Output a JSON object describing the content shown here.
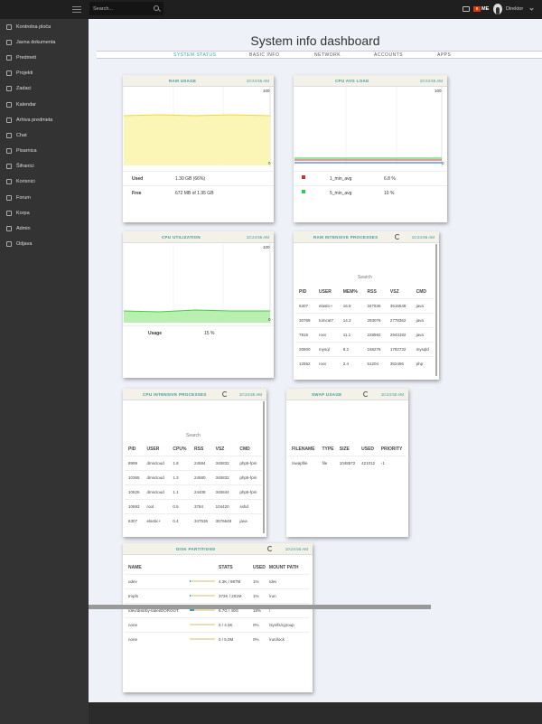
{
  "search": {
    "placeholder": "Search..."
  },
  "header": {
    "language": "ME",
    "user": "Direktor"
  },
  "sidebar": {
    "items": [
      {
        "label": "Kontrolna ploča",
        "icon": "dashboard-icon"
      },
      {
        "label": "Javna dokumenta",
        "icon": "document-icon"
      },
      {
        "label": "Predmeti",
        "icon": "inbox-icon"
      },
      {
        "label": "Projekti",
        "icon": "projects-icon"
      },
      {
        "label": "Zadaci",
        "icon": "tasks-icon"
      },
      {
        "label": "Kalendar",
        "icon": "calendar-icon"
      },
      {
        "label": "Arhiva predmeta",
        "icon": "archive-icon"
      },
      {
        "label": "Chat",
        "icon": "chat-icon"
      },
      {
        "label": "Pisarnica",
        "icon": "edit-icon"
      },
      {
        "label": "Šifranici",
        "icon": "wrench-icon"
      },
      {
        "label": "Korisnici",
        "icon": "users-icon"
      },
      {
        "label": "Forum",
        "icon": "forum-icon"
      },
      {
        "label": "Korpa",
        "icon": "basket-icon"
      },
      {
        "label": "Admin",
        "icon": "admin-icon"
      },
      {
        "label": "Odjava",
        "icon": "logout-icon"
      }
    ]
  },
  "page": {
    "title": "System info dashboard",
    "tabs": [
      "SYSTEM STATUS",
      "BASIC INFO",
      "NETWORK",
      "ACCOUNTS",
      "APPS"
    ]
  },
  "ram": {
    "title": "RAM USAGE",
    "time": "10:24:56 AM",
    "ymax": "100",
    "ymin": "0",
    "used_label": "Used",
    "used_value": "1.30 GB (66%)",
    "free_label": "Free",
    "free_value": "672 MB of 1.95 GB",
    "fill_color": "#fbf5b6",
    "line_color": "#f0d830"
  },
  "cpu_load": {
    "title": "CPU AVG LOAD",
    "time": "10:24:55 AM",
    "ymax": "100",
    "ymin": "0",
    "legend": [
      {
        "name": "1_min_avg",
        "value": "6.8 %",
        "color": "#c0392b"
      },
      {
        "name": "5_min_avg",
        "value": "10 %",
        "color": "#2ecc40"
      }
    ]
  },
  "cpu_util": {
    "title": "CPU UTILIZATION",
    "time": "10:24:55 AM",
    "ymax": "100",
    "ymin": "0",
    "usage_label": "Usage",
    "usage_value": "15 %",
    "fill_color": "#b8f0b0",
    "line_color": "#44cc44"
  },
  "ram_proc": {
    "title": "RAM INTENSIVE PROCESSES",
    "time": "10:24:56 AM",
    "search": "Search",
    "headers": [
      "PID",
      "USER",
      "MEM%",
      "RSS",
      "VSZ",
      "CMD"
    ],
    "rows": [
      [
        "6307",
        "elastic+",
        "16.9",
        "347536",
        "3516548",
        "java"
      ],
      [
        "30769",
        "tomcat7",
        "14.3",
        "293076",
        "2778362",
        "java"
      ],
      [
        "7815",
        "root",
        "11.1",
        "228592",
        "2943192",
        "java"
      ],
      [
        "20800",
        "mysql",
        "8.2",
        "168276",
        "1792732",
        "mysqld"
      ],
      [
        "12552",
        "root",
        "2.4",
        "51204",
        "352456",
        "php"
      ]
    ]
  },
  "cpu_proc": {
    "title": "CPU INTENSIVE PROCESSES",
    "time": "10:24:55 AM",
    "search": "Search",
    "headers": [
      "PID",
      "USER",
      "CPU%",
      "RSS",
      "VSZ",
      "CMD"
    ],
    "rows": [
      [
        "8999",
        "dmscloud",
        "1.8",
        "24584",
        "345832",
        "php5-fpm"
      ],
      [
        "10365",
        "dmscloud",
        "1.3",
        "24580",
        "345832",
        "php5-fpm"
      ],
      [
        "10626",
        "dmscloud",
        "1.1",
        "24408",
        "345844",
        "php5-fpm"
      ],
      [
        "10693",
        "root",
        "0.5",
        "3784",
        "104420",
        "sshd"
      ],
      [
        "6307",
        "elastic+",
        "0.4",
        "347536",
        "3576648",
        "java"
      ]
    ]
  },
  "swap": {
    "title": "SWAP USAGE",
    "time": "10:24:55 AM",
    "headers": [
      "FILENAME",
      "TYPE",
      "SIZE",
      "USED",
      "PRIORITY"
    ],
    "rows": [
      [
        "/swapfile",
        "file",
        "1048572",
        "421012",
        "-1"
      ]
    ]
  },
  "disk": {
    "title": "DISK PARTITIONS",
    "time": "10:24:56 AM",
    "headers": [
      "NAME",
      "",
      "STATS",
      "USED",
      "MOUNT PATH"
    ],
    "rows": [
      {
        "name": "udev",
        "stats": "4.3K / 987M",
        "used": "1%",
        "mount": "/dev",
        "fill": 0.01
      },
      {
        "name": "tmpfs",
        "stats": "372K / 201M",
        "used": "1%",
        "mount": "/run",
        "fill": 0.01
      },
      {
        "name": "/dev/disk/by-label/DOROOT",
        "stats": "6.7G / 40G",
        "used": "18%",
        "mount": "/",
        "fill": 0.18
      },
      {
        "name": "none",
        "stats": "0 / 4.0K",
        "used": "0%",
        "mount": "/sys/fs/cgroup",
        "fill": 0
      },
      {
        "name": "none",
        "stats": "0 / 5.0M",
        "used": "0%",
        "mount": "/run/lock",
        "fill": 0
      }
    ]
  }
}
